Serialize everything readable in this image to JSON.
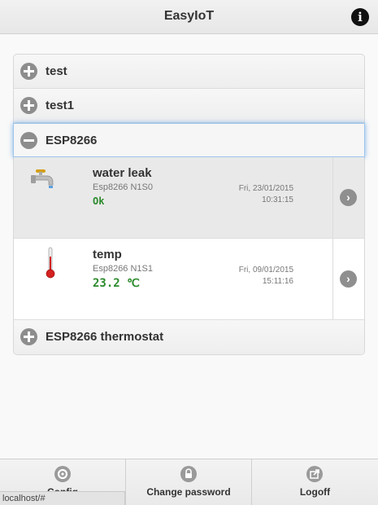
{
  "header": {
    "title": "EasyIoT",
    "info_icon": "info-icon"
  },
  "groups": [
    {
      "label": "test",
      "icon": "plus-icon"
    },
    {
      "label": "test1",
      "icon": "plus-icon"
    },
    {
      "label": "ESP8266",
      "icon": "minus-icon",
      "sensors": [
        {
          "name": "water leak",
          "node": "Esp8266 N1S0",
          "value": "Ok",
          "date": "Fri, 23/01/2015",
          "time": "10:31:15",
          "icon": "faucet-icon"
        },
        {
          "name": "temp",
          "node": "Esp8266 N1S1",
          "value": "23.2 ℃",
          "date": "Fri, 09/01/2015",
          "time": "15:11:16",
          "icon": "thermometer-icon"
        }
      ]
    },
    {
      "label": "ESP8266 thermostat",
      "icon": "plus-icon"
    }
  ],
  "footer": {
    "buttons": [
      {
        "label": "Config",
        "icon": "gear-icon"
      },
      {
        "label": "Change password",
        "icon": "lock-icon"
      },
      {
        "label": "Logoff",
        "icon": "logout-icon"
      }
    ],
    "status_url": "localhost/#"
  },
  "colors": {
    "value_green": "#2b8a2b",
    "focus_blue": "#7fb2e6"
  }
}
